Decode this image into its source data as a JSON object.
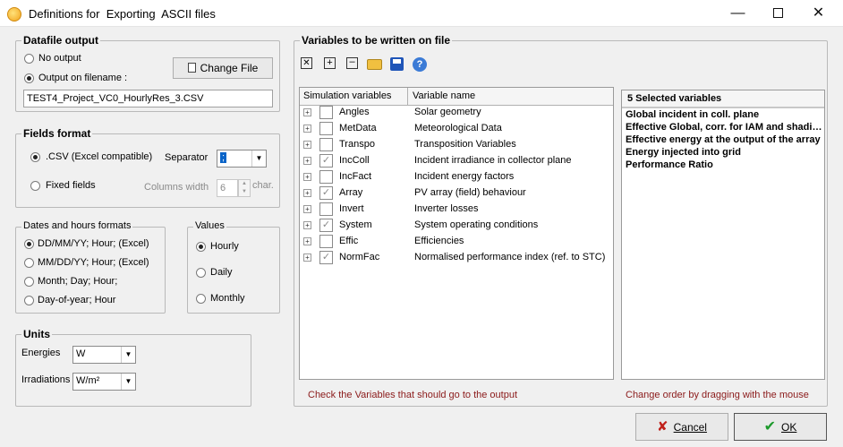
{
  "window": {
    "title": "Definitions for  Exporting  ASCII files",
    "min": "—",
    "close": "✕"
  },
  "datafile": {
    "legend": "Datafile output",
    "no_output": "No output",
    "output_on_filename": "Output on filename :",
    "change_file": "Change File",
    "filename": "TEST4_Project_VC0_HourlyRes_3.CSV"
  },
  "fields": {
    "legend": "Fields format",
    "csv": ".CSV  (Excel compatible)",
    "separator_label": "Separator",
    "separator_value": ";",
    "fixed": "Fixed fields",
    "columns_width": "Columns width",
    "columns_value": "6",
    "char": "char."
  },
  "dates": {
    "legend": "Dates and hours formats",
    "opt1": "DD/MM/YY; Hour;  (Excel)",
    "opt2": "MM/DD/YY; Hour;  (Excel)",
    "opt3": "Month; Day; Hour;",
    "opt4": "Day-of-year; Hour"
  },
  "values": {
    "legend": "Values",
    "hourly": "Hourly",
    "daily": "Daily",
    "monthly": "Monthly"
  },
  "units": {
    "legend": "Units",
    "energies_label": "Energies",
    "energies_value": "W",
    "irradiations_label": "Irradiations",
    "irradiations_value": "W/m²"
  },
  "variables": {
    "legend": "Variables to be written on file",
    "col_sim": "Simulation variables",
    "col_name": "Variable name",
    "rows": [
      {
        "code": "Angles",
        "desc": "Solar geometry",
        "checked": false
      },
      {
        "code": "MetData",
        "desc": "Meteorological Data",
        "checked": false
      },
      {
        "code": "Transpo",
        "desc": "Transposition Variables",
        "checked": false
      },
      {
        "code": "IncColl",
        "desc": "Incident irradiance in collector plane",
        "checked": true
      },
      {
        "code": "IncFact",
        "desc": "Incident energy factors",
        "checked": false
      },
      {
        "code": "Array",
        "desc": "PV array (field) behaviour",
        "checked": true
      },
      {
        "code": "Invert",
        "desc": "Inverter losses",
        "checked": false
      },
      {
        "code": "System",
        "desc": "System operating conditions",
        "checked": true
      },
      {
        "code": "Effic",
        "desc": "Efficiencies",
        "checked": false
      },
      {
        "code": "NormFac",
        "desc": "Normalised performance index (ref. to STC)",
        "checked": true
      }
    ],
    "hint_left": "Check the Variables that should go to the output",
    "hint_right": "Change order by dragging with the mouse"
  },
  "selected": {
    "header": "5 Selected variables",
    "items": [
      "Global incident in coll. plane",
      "Effective Global, corr. for IAM and shadings",
      "Effective energy at the output of the array",
      "Energy injected into grid",
      "Performance Ratio"
    ]
  },
  "buttons": {
    "cancel": "Cancel",
    "ok": "OK"
  }
}
